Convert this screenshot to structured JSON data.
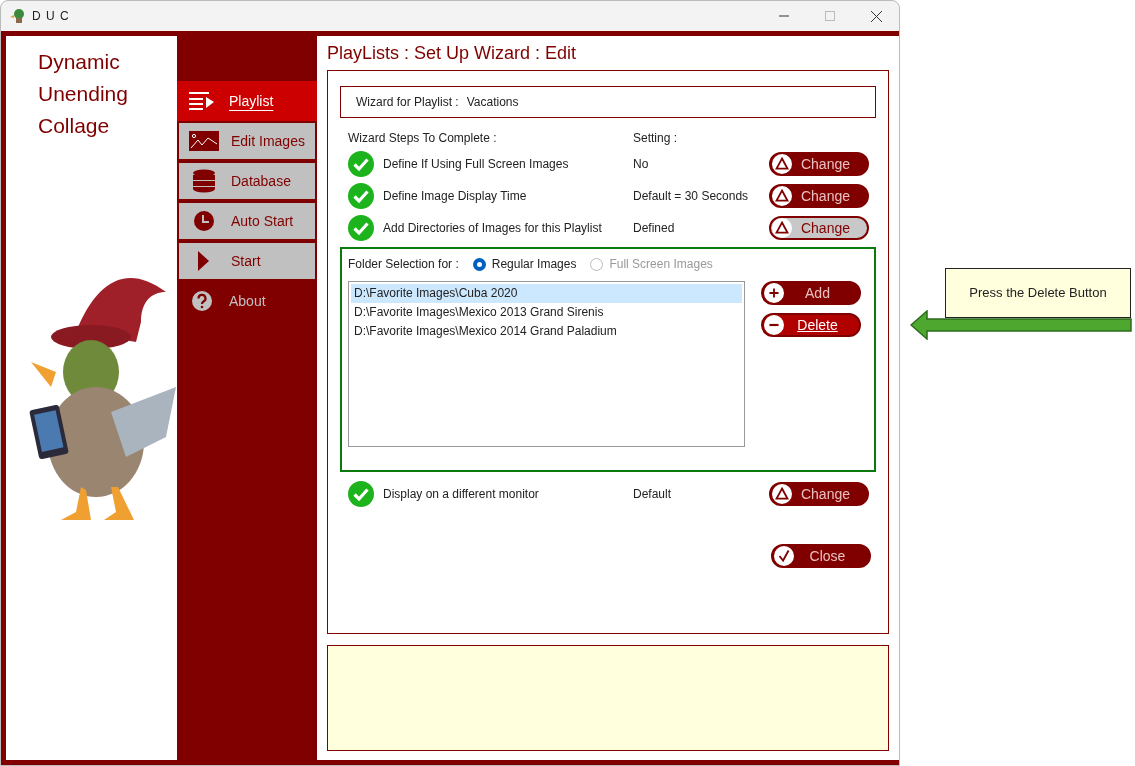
{
  "window": {
    "title": "D U C"
  },
  "app_name": [
    "Dynamic",
    "Unending",
    "Collage"
  ],
  "nav": [
    {
      "label": "Playlist",
      "kind": "tile",
      "selected": true
    },
    {
      "label": "Edit Images",
      "kind": "tile",
      "selected": false
    },
    {
      "label": "Database",
      "kind": "tile",
      "selected": false
    },
    {
      "label": "Auto Start",
      "kind": "tile",
      "selected": false
    },
    {
      "label": "Start",
      "kind": "tile",
      "selected": false
    },
    {
      "label": "About",
      "kind": "plain",
      "selected": false
    }
  ],
  "page_title": "PlayLists : Set Up Wizard : Edit",
  "wizard": {
    "label": "Wizard for Playlist :",
    "value": "Vacations"
  },
  "headers": {
    "steps": "Wizard Steps To Complete :",
    "setting": "Setting :"
  },
  "steps": [
    {
      "label": "Define If Using Full Screen Images",
      "setting": "No",
      "button": "Change",
      "disabled": false
    },
    {
      "label": "Define Image Display Time",
      "setting": "Default = 30 Seconds",
      "button": "Change",
      "disabled": false
    },
    {
      "label": "Add Directories of Images for this Playlist",
      "setting": "Defined",
      "button": "Change",
      "disabled": true
    }
  ],
  "folder_selection": {
    "label": "Folder Selection for :",
    "options": [
      {
        "label": "Regular Images",
        "selected": true,
        "disabled": false
      },
      {
        "label": "Full Screen Images",
        "selected": false,
        "disabled": true
      }
    ],
    "folders": [
      {
        "label": "D:\\Favorite Images\\Cuba 2020",
        "selected": true
      },
      {
        "label": "D:\\Favorite Images\\Mexico 2013 Grand Sirenis",
        "selected": false
      },
      {
        "label": "D:\\Favorite Images\\Mexico 2014 Grand Paladium",
        "selected": false
      }
    ],
    "buttons": [
      {
        "label": "Add",
        "focused": false
      },
      {
        "label": "Delete",
        "focused": true
      }
    ]
  },
  "last_step": {
    "label": "Display on a different monitor",
    "setting": "Default",
    "button": "Change",
    "disabled": false
  },
  "close_button": "Close",
  "callout": "Press the Delete Button"
}
